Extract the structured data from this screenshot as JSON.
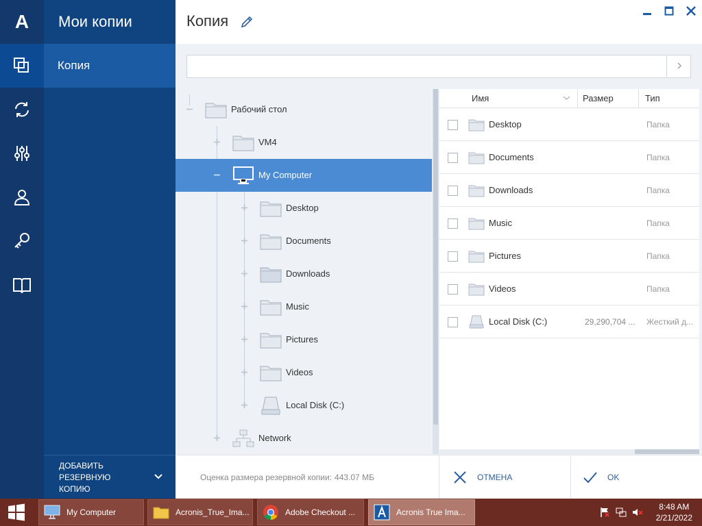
{
  "sidebar": {
    "title": "Мои копии",
    "active_item": "Копия",
    "add_backup": [
      "ДОБАВИТЬ",
      "РЕЗЕРВНУЮ",
      "КОПИЮ"
    ]
  },
  "rail": {
    "logo": "A",
    "icons": [
      "copy-icon",
      "sync-icon",
      "tools-icon",
      "account-icon",
      "key-icon",
      "book-icon"
    ]
  },
  "header": {
    "title": "Копия"
  },
  "path": {
    "value": ""
  },
  "tree": {
    "root": "Рабочий стол",
    "vm": "VM4",
    "computer": "My Computer",
    "children": [
      "Desktop",
      "Documents",
      "Downloads",
      "Music",
      "Pictures",
      "Videos",
      "Local Disk (C:)"
    ],
    "network": "Network"
  },
  "list": {
    "columns": {
      "name": "Имя",
      "size": "Размер",
      "type": "Тип"
    },
    "rows": [
      {
        "name": "Desktop",
        "size": "",
        "type": "Папка",
        "icon": "folder-icon"
      },
      {
        "name": "Documents",
        "size": "",
        "type": "Папка",
        "icon": "folder-icon"
      },
      {
        "name": "Downloads",
        "size": "",
        "type": "Папка",
        "icon": "folder-icon"
      },
      {
        "name": "Music",
        "size": "",
        "type": "Папка",
        "icon": "folder-icon"
      },
      {
        "name": "Pictures",
        "size": "",
        "type": "Папка",
        "icon": "folder-icon"
      },
      {
        "name": "Videos",
        "size": "",
        "type": "Папка",
        "icon": "folder-icon"
      },
      {
        "name": "Local Disk (C:)",
        "size": "29,290,704 ...",
        "type": "Жесткий д...",
        "icon": "disk-icon"
      }
    ]
  },
  "footer": {
    "estimate_label": "Оценка размера резервной копии:",
    "estimate_value": "443.07 МБ",
    "cancel": "ОТМЕНА",
    "ok": "OK"
  },
  "taskbar": {
    "tasks": [
      "My Computer",
      "Acronis_True_Ima...",
      "Adobe Checkout ...",
      "Acronis True Ima..."
    ],
    "time": "8:48 AM",
    "date": "2/21/2022"
  },
  "colors": {
    "rail": "#13386b",
    "sidebar": "#0f4480",
    "selected": "#4a8bd4",
    "taskbar": "#6b2a22"
  }
}
